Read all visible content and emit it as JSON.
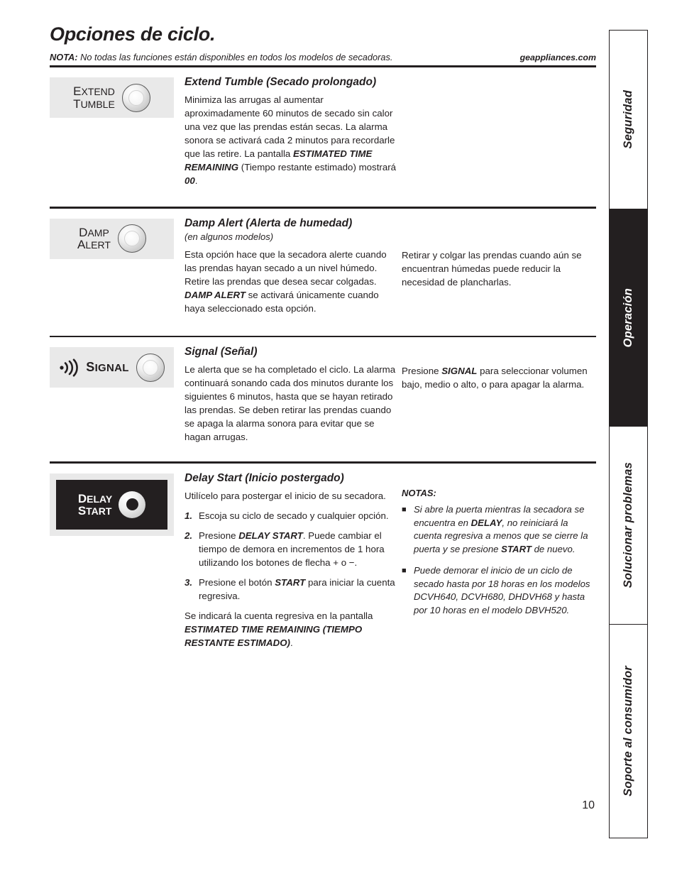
{
  "page": {
    "title": "Opciones de ciclo.",
    "note_label": "NOTA:",
    "note_text": " No todas las funciones están disponibles en todos los modelos de secadoras.",
    "website": "geappliances.com",
    "page_number": "10"
  },
  "sidebar": {
    "tabs": [
      {
        "label": "Seguridad",
        "active": false
      },
      {
        "label": "Operación",
        "active": true
      },
      {
        "label": "Solucionar problemas",
        "active": false
      },
      {
        "label": "Soporte al consumidor",
        "active": false
      }
    ]
  },
  "sections": [
    {
      "id": "extend-tumble",
      "button": {
        "line1_first": "E",
        "line1_rest": "XTEND",
        "line2_first": "T",
        "line2_rest": "UMBLE"
      },
      "heading": "Extend Tumble (Secado prolongado)",
      "body_1": "Minimiza las arrugas al aumentar aproximadamente 60 minutos de secado sin calor una vez que las prendas están secas. La alarma sonora se activará cada 2 minutos para recordarle que las retire. La pantalla ",
      "body_1_bold": "ESTIMATED TIME REMAINING",
      "body_1_tail": " (Tiempo restante estimado) mostrará ",
      "body_1_bold2": "00",
      "body_1_end": "."
    },
    {
      "id": "damp-alert",
      "button": {
        "line1_first": "D",
        "line1_rest": "AMP",
        "line2_first": "A",
        "line2_rest": "LERT"
      },
      "heading": "Damp Alert (Alerta de humedad)",
      "subtitle": "(en algunos modelos)",
      "body_1": "Esta opción hace que la secadora alerte cuando las prendas hayan secado a un nivel húmedo. Retire las prendas que desea secar colgadas. ",
      "body_1_bold": "DAMP ALERT",
      "body_1_tail": " se activará únicamente cuando haya seleccionado esta opción.",
      "right_text": "Retirar y colgar las prendas cuando aún se encuentran húmedas puede reducir la necesidad de plancharlas."
    },
    {
      "id": "signal",
      "button": {
        "word_first": "S",
        "word_rest": "IGNAL",
        "icon": "sound-waves-icon"
      },
      "heading": "Signal (Señal)",
      "body_1": "Le alerta que se ha completado el ciclo. La alarma continuará sonando cada dos minutos durante los siguientes 6 minutos, hasta que se hayan retirado las prendas. Se deben retirar las prendas cuando se apaga la alarma sonora para evitar que se hagan arrugas.",
      "right_lead": "Presione ",
      "right_bold": "SIGNAL",
      "right_tail": " para seleccionar volumen bajo, medio o alto, o para apagar la alarma."
    },
    {
      "id": "delay-start",
      "button": {
        "line1_first": "D",
        "line1_rest": "ELAY",
        "line2_first": "S",
        "line2_rest": "TART"
      },
      "heading": "Delay Start (Inicio postergado)",
      "body_1": "Utilícelo para postergar el inicio de su secadora.",
      "steps": [
        {
          "num": "1.",
          "lead": "Escoja su ciclo de secado y cualquier opción.",
          "bold": "",
          "tail": ""
        },
        {
          "num": "2.",
          "lead": "Presione ",
          "bold": "DELAY START",
          "tail": ". Puede cambiar el tiempo de demora en incrementos de 1 hora utilizando los botones de flecha + o −."
        },
        {
          "num": "3.",
          "lead": "Presione el botón ",
          "bold": "START",
          "tail": " para iniciar la cuenta regresiva."
        }
      ],
      "closing_lead": "Se indicará la cuenta regresiva en la pantalla ",
      "closing_bold": "ESTIMATED TIME REMAINING (TIEMPO RESTANTE ESTIMADO)",
      "closing_tail": ".",
      "notas_title": "NOTAS:",
      "notas": [
        {
          "lead": "Si abre la puerta mientras la secadora se encuentra en ",
          "bold": "DELAY",
          "mid": ", no reiniciará la cuenta regresiva a menos que se cierre la puerta y se presione ",
          "bold2": "START",
          "tail": " de nuevo."
        },
        {
          "lead": "Puede demorar el inicio de un ciclo de secado hasta por 18 horas en los modelos DCVH640, DCVH680, DHDVH68 y hasta por 10 horas en el modelo DBVH520.",
          "bold": "",
          "mid": "",
          "bold2": "",
          "tail": ""
        }
      ]
    }
  ],
  "colors": {
    "ink": "#231f20",
    "chip_bg": "#e9e9e9",
    "active_tab": "#231f20"
  }
}
